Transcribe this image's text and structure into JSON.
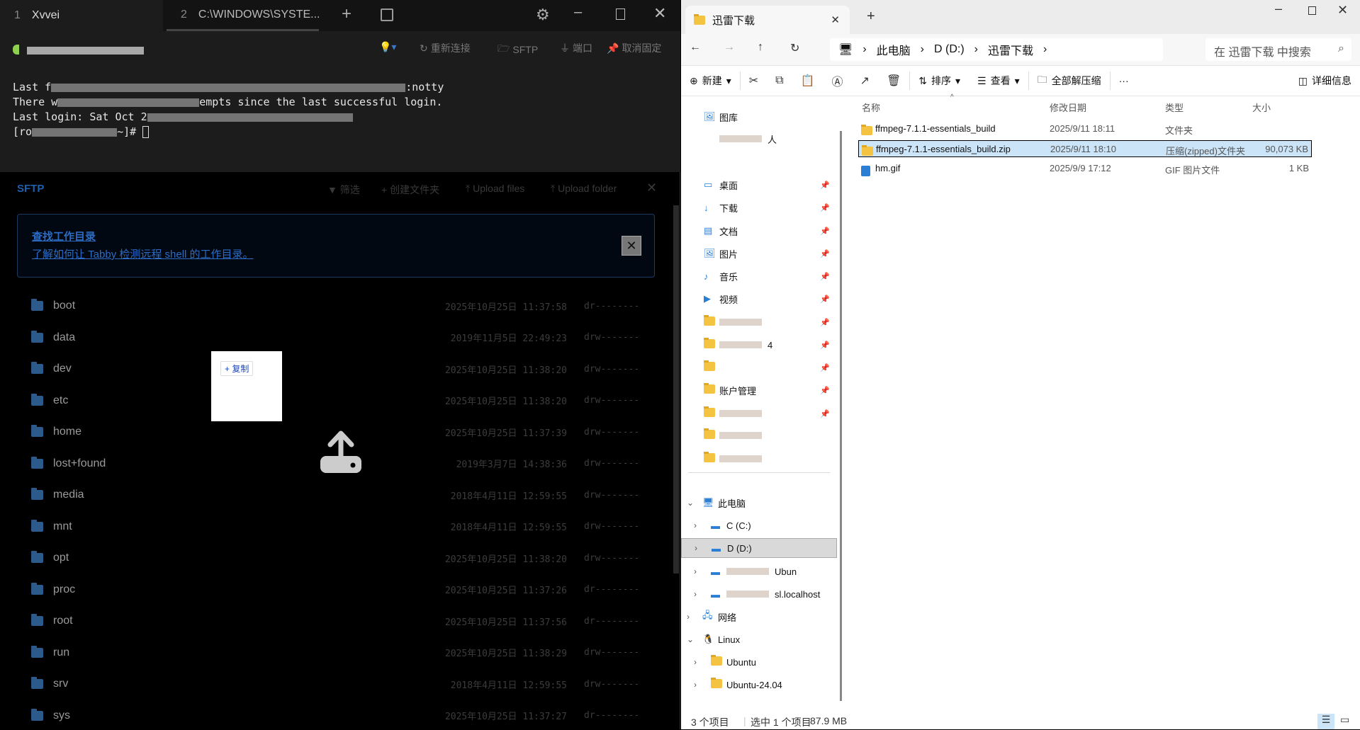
{
  "tabby": {
    "tabs": [
      {
        "num": "1",
        "label": "Xvvei"
      },
      {
        "num": "2",
        "label": "C:\\WINDOWS\\SYSTE..."
      }
    ],
    "toolbar": {
      "reconnect": "重新连接",
      "sftp": "SFTP",
      "ports": "端口",
      "unpin": "取消固定"
    },
    "terminal": {
      "lines": [
        "Last f",
        "There w",
        "Last login: Sat Oct 2",
        "[ro"
      ],
      "line1_tail": ":notty",
      "line2_tail": "empts since the last successful login.",
      "prompt_tail": "~]# "
    },
    "sftp": {
      "title": "SFTP",
      "filter": "筛选",
      "create_folder": "创建文件夹",
      "upload_files": "Upload files",
      "upload_folder": "Upload folder",
      "info_title": "查找工作目录",
      "info_link": "了解如何让 Tabby 检测远程 shell 的工作目录。",
      "popup_copy": "+ 复制",
      "files": [
        {
          "name": "boot",
          "date": "2025年10月25日 11:37:58",
          "perm": "dr--------"
        },
        {
          "name": "data",
          "date": "2019年11月5日 22:49:23",
          "perm": "drw-------"
        },
        {
          "name": "dev",
          "date": "2025年10月25日 11:38:20",
          "perm": "drw-------"
        },
        {
          "name": "etc",
          "date": "2025年10月25日 11:38:20",
          "perm": "drw-------"
        },
        {
          "name": "home",
          "date": "2025年10月25日 11:37:39",
          "perm": "drw-------"
        },
        {
          "name": "lost+found",
          "date": "2019年3月7日 14:38:36",
          "perm": "drw-------"
        },
        {
          "name": "media",
          "date": "2018年4月11日 12:59:55",
          "perm": "drw-------"
        },
        {
          "name": "mnt",
          "date": "2018年4月11日 12:59:55",
          "perm": "drw-------"
        },
        {
          "name": "opt",
          "date": "2025年10月25日 11:38:20",
          "perm": "drw-------"
        },
        {
          "name": "proc",
          "date": "2025年10月25日 11:37:26",
          "perm": "dr--------"
        },
        {
          "name": "root",
          "date": "2025年10月25日 11:37:56",
          "perm": "dr--------"
        },
        {
          "name": "run",
          "date": "2025年10月25日 11:38:29",
          "perm": "drw-------"
        },
        {
          "name": "srv",
          "date": "2018年4月11日 12:59:55",
          "perm": "drw-------"
        },
        {
          "name": "sys",
          "date": "2025年10月25日 11:37:27",
          "perm": "dr--------"
        }
      ]
    }
  },
  "explorer": {
    "tab_title": "迅雷下载",
    "breadcrumb": [
      "此电脑",
      "D (D:)",
      "迅雷下载"
    ],
    "search_placeholder": "在 迅雷下载 中搜索",
    "commands": {
      "new": "新建",
      "sort": "排序",
      "view": "查看",
      "extract_all": "全部解压缩",
      "more": "···",
      "details": "详细信息"
    },
    "columns": [
      "名称",
      "修改日期",
      "类型",
      "大小"
    ],
    "files": [
      {
        "name": "ffmpeg-7.1.1-essentials_build",
        "date": "2025/9/11 18:11",
        "type": "文件夹",
        "size": "",
        "icon": "folder"
      },
      {
        "name": "ffmpeg-7.1.1-essentials_build.zip",
        "date": "2025/9/11 18:10",
        "type": "压缩(zipped)文件夹",
        "size": "90,073 KB",
        "icon": "zip",
        "selected": true
      },
      {
        "name": "hm.gif",
        "date": "2025/9/9 17:12",
        "type": "GIF 图片文件",
        "size": "1 KB",
        "icon": "gif"
      }
    ],
    "nav": [
      {
        "label": "图库",
        "icon": "🖼",
        "indent": 1
      },
      {
        "label": "人",
        "icon": "",
        "indent": 1,
        "blur": true
      },
      {
        "sep": true
      },
      {
        "label": "桌面",
        "icon": "▭",
        "pin": true
      },
      {
        "label": "下载",
        "icon": "↓",
        "pin": true
      },
      {
        "label": "文档",
        "icon": "▤",
        "pin": true
      },
      {
        "label": "图片",
        "icon": "🖼",
        "pin": true
      },
      {
        "label": "音乐",
        "icon": "♪",
        "pin": true
      },
      {
        "label": "视频",
        "icon": "▶",
        "pin": true
      },
      {
        "label": "",
        "icon": "folder",
        "pin": true,
        "blur": true
      },
      {
        "label": "4",
        "icon": "folder",
        "pin": true,
        "blur": true
      },
      {
        "label": "",
        "icon": "folder",
        "pin": true
      },
      {
        "label": "账户管理",
        "icon": "folder",
        "pin": true
      },
      {
        "label": "",
        "icon": "folder",
        "pin": true,
        "blur": true
      },
      {
        "label": "",
        "icon": "folder",
        "blur": true
      },
      {
        "label": "",
        "icon": "folder",
        "blur": true
      },
      {
        "divider": true
      },
      {
        "label": "此电脑",
        "icon": "🖥",
        "chev": "v",
        "level": 0
      },
      {
        "label": "C (C:)",
        "icon": "▬",
        "chev": ">",
        "level": 1
      },
      {
        "label": "D (D:)",
        "icon": "▬",
        "chev": ">",
        "level": 1,
        "selected": true
      },
      {
        "label": "Ubun",
        "icon": "▬",
        "chev": ">",
        "level": 1,
        "blur": true
      },
      {
        "label": "sl.localhost",
        "icon": "▬",
        "chev": ">",
        "level": 1,
        "blur": true
      },
      {
        "label": "网络",
        "icon": "🖧",
        "chev": ">",
        "level": 0
      },
      {
        "label": "Linux",
        "icon": "🐧",
        "chev": "v",
        "level": 0
      },
      {
        "label": "Ubuntu",
        "icon": "folder",
        "chev": ">",
        "level": 1
      },
      {
        "label": "Ubuntu-24.04",
        "icon": "folder",
        "chev": ">",
        "level": 1
      }
    ],
    "status": {
      "count": "3 个项目",
      "selected": "选中 1 个项目",
      "size": "87.9 MB"
    }
  }
}
